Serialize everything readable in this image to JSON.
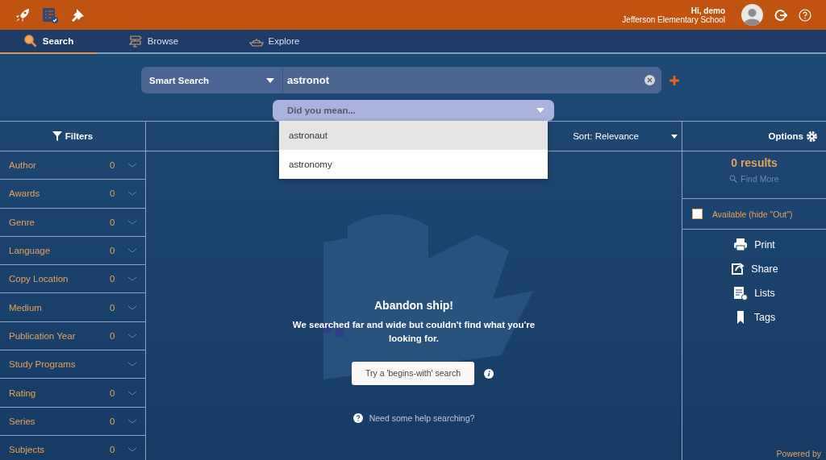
{
  "header": {
    "greeting": "Hi, demo",
    "school": "Jefferson Elementary School"
  },
  "tabs": [
    {
      "label": "Search",
      "kind": "search",
      "selected": true
    },
    {
      "label": "Browse",
      "kind": "browse",
      "selected": false
    },
    {
      "label": "Explore",
      "kind": "explore",
      "selected": false
    }
  ],
  "search": {
    "type": "Smart Search",
    "value": "astronot"
  },
  "suggestions": {
    "title": "Did you mean...",
    "options": [
      {
        "label": "astronaut",
        "selected": true
      },
      {
        "label": "astronomy",
        "selected": false
      }
    ]
  },
  "filters": {
    "title": "Filters",
    "items": [
      {
        "label": "Author",
        "count": "0"
      },
      {
        "label": "Awards",
        "count": "0"
      },
      {
        "label": "Genre",
        "count": "0"
      },
      {
        "label": "Language",
        "count": "0"
      },
      {
        "label": "Copy Location",
        "count": "0"
      },
      {
        "label": "Medium",
        "count": "0"
      },
      {
        "label": "Publication Year",
        "count": "0"
      },
      {
        "label": "Study Programs"
      },
      {
        "label": "Rating",
        "count": "0"
      },
      {
        "label": "Series",
        "count": "0"
      },
      {
        "label": "Subjects",
        "count": "0"
      }
    ]
  },
  "sort": "Sort: Relevance",
  "empty": {
    "title": "Abandon ship!",
    "message": "We searched far and wide but couldn't find what you're looking for.",
    "button": "Try a 'begins-with' search",
    "help": "Need some help searching?"
  },
  "options": {
    "title": "Options",
    "results": "0 results",
    "find_more": "Find More",
    "available": {
      "label": "Available (hide \"Out\")",
      "checked": false
    },
    "actions": [
      {
        "label": "Print",
        "kind": "print"
      },
      {
        "label": "Share",
        "kind": "share"
      },
      {
        "label": "Lists",
        "kind": "lists"
      },
      {
        "label": "Tags",
        "kind": "tags"
      }
    ],
    "footer": "Powered by"
  }
}
